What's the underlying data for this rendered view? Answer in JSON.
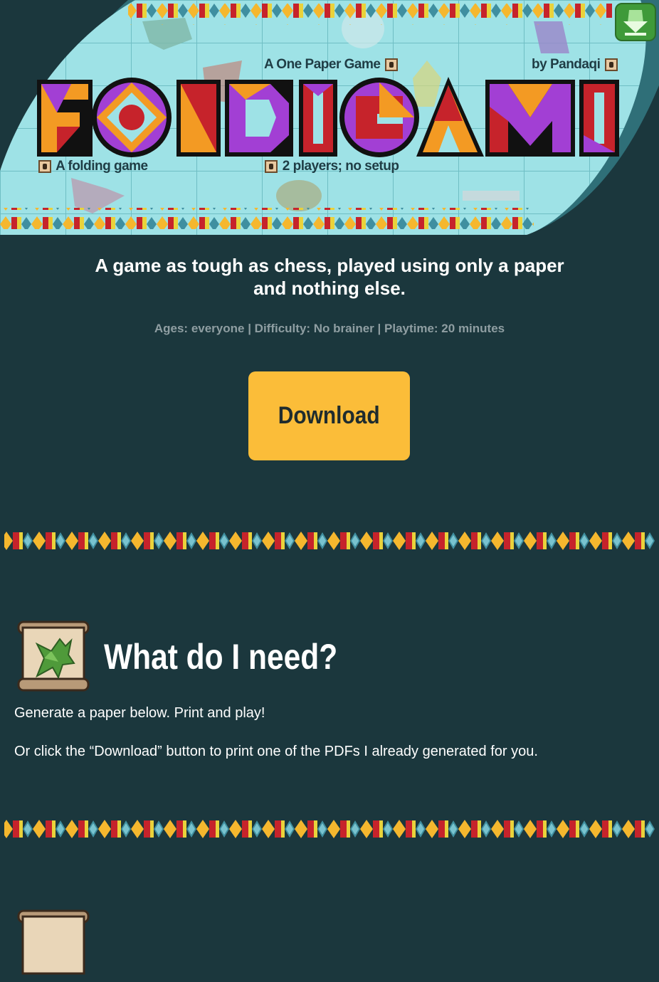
{
  "header": {
    "logo_text": "FOLDIGAMI",
    "subtitle": "A One Paper Game",
    "author": "by Pandaqi",
    "genre": "A folding game",
    "players": "2 players; no setup"
  },
  "hero": {
    "tagline": "A game as tough as chess, played using only a paper and nothing else.",
    "meta": "Ages: everyone | Difficulty: No brainer | Playtime: 20 minutes",
    "download_label": "Download"
  },
  "sections": [
    {
      "heading": "What do I need?",
      "paragraphs": [
        "Generate a paper below. Print and play!",
        "Or click the “Download” button to print one of the PDFs I already generated for you."
      ]
    }
  ],
  "icons": {
    "home": "home-arrow-icon",
    "section_1": "dragon-scroll-icon",
    "section_2": "scroll-icon"
  },
  "colors": {
    "background": "#1b373d",
    "accent": "#fbbd39",
    "meta_text": "#8f9ea2",
    "banner_bg": "#9ee2e6"
  }
}
